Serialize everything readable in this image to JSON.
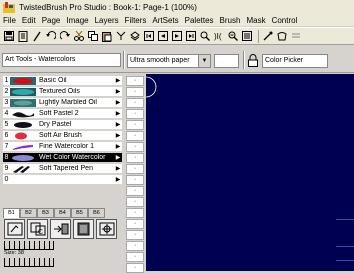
{
  "window": {
    "title": "TwistedBrush Pro Studio : Book-1: Page-1 (100%)"
  },
  "menu": [
    "File",
    "Edit",
    "Page",
    "Image",
    "Layers",
    "Filters",
    "ArtSets",
    "Palettes",
    "Brush",
    "Mask",
    "Control"
  ],
  "toolbar": {
    "icons": [
      "save-icon",
      "book-icon",
      "pencil-icon",
      "undo-icon",
      "redo-icon",
      "cut-icon",
      "copy-icon",
      "paste-icon",
      "merge-icon",
      "layer-icon",
      "page-first-icon",
      "page-prev-icon",
      "page-next-icon",
      "page-last-icon",
      "zoom-icon",
      "grid-icon",
      "zoom-fit-icon",
      "eyedropper-icon",
      "bucket-icon",
      "overflow-icon"
    ]
  },
  "options": {
    "artset_label": "Art Tools - Watercolors",
    "paper_value": "Ultra smooth paper",
    "color_picker_label": "Color Picker"
  },
  "brushes": [
    {
      "num": "1",
      "name": "Basic Oil",
      "color": "#d01018"
    },
    {
      "num": "2",
      "name": "Textured Oils",
      "color": "#30a8a8"
    },
    {
      "num": "3",
      "name": "Lightly Marbled Oil",
      "color": "#2f7070"
    },
    {
      "num": "4",
      "name": "Soft Pastel 2",
      "color": "#101018"
    },
    {
      "num": "5",
      "name": "Dry Pastel",
      "color": "#101018"
    },
    {
      "num": "6",
      "name": "Soft Air Brush",
      "color": "#e03040"
    },
    {
      "num": "7",
      "name": "Fine Watercolor 1",
      "color": "#8a2be2"
    },
    {
      "num": "8",
      "name": "Wet Color Watercolor",
      "color": "#8a8ad0"
    },
    {
      "num": "9",
      "name": "Soft Tapered Pen",
      "color": "#101018"
    },
    {
      "num": "0",
      "name": "",
      "color": "#ffffff"
    }
  ],
  "selected_brush_index": 7,
  "brush_tabs": [
    "B1",
    "B2",
    "B3",
    "B4",
    "B5",
    "B6"
  ],
  "size_label": "Size: 38",
  "dot_cells": [
    "·",
    "·",
    "·",
    "·",
    "·",
    "·",
    "·",
    "·",
    "·",
    "·",
    "·",
    "·",
    "·",
    "·",
    "·",
    "·",
    "·",
    "·"
  ],
  "colors": {
    "canvas": "#000050",
    "selected_row": "#000000",
    "chrome": "#d6d3ce"
  }
}
